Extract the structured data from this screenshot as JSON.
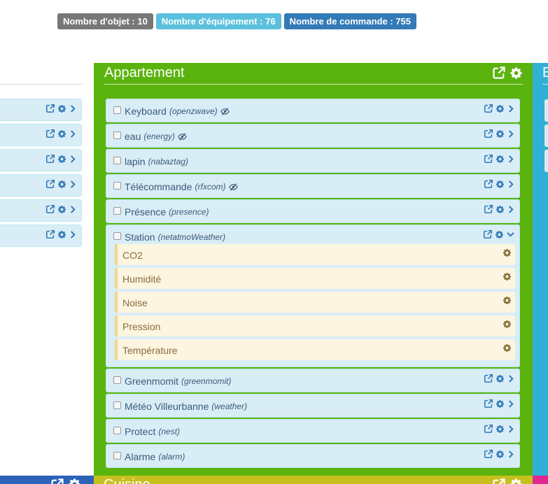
{
  "badges": {
    "objects": "Nombre d'objet : 10",
    "equipments": "Nombre d'équipement : 76",
    "commands": "Nombre de commande : 755"
  },
  "colors": {
    "badge_objects": "#777777",
    "badge_equipments": "#5bc0de",
    "badge_commands": "#337ab7",
    "panel_green": "#5bb30e",
    "panel_blue": "#31b0d5",
    "panel_dark_blue": "#2c63b8",
    "panel_yellow": "#c8c01e",
    "panel_pink": "#e0268f"
  },
  "right_panel": {
    "title": "E"
  },
  "panel": {
    "title": "Appartement",
    "equipments": [
      {
        "name": "Keyboard",
        "plugin": "(openzwave)",
        "hidden_icon": true
      },
      {
        "name": "eau",
        "plugin": "(energy)",
        "hidden_icon": true
      },
      {
        "name": "lapin",
        "plugin": "(nabaztag)",
        "hidden_icon": false
      },
      {
        "name": "Télécommande",
        "plugin": "(rfxcom)",
        "hidden_icon": true
      },
      {
        "name": "Présence",
        "plugin": "(presence)",
        "hidden_icon": false
      },
      {
        "name": "Station",
        "plugin": "(netatmoWeather)",
        "hidden_icon": false,
        "expanded": true,
        "commands": [
          "CO2",
          "Humidité",
          "Noise",
          "Pression",
          "Température"
        ]
      },
      {
        "name": "Greenmomit",
        "plugin": "(greenmomit)",
        "hidden_icon": false
      },
      {
        "name": "Météo Villeurbanne",
        "plugin": "(weather)",
        "hidden_icon": false
      },
      {
        "name": "Protect",
        "plugin": "(nest)",
        "hidden_icon": false
      },
      {
        "name": "Alarme",
        "plugin": "(alarm)",
        "hidden_icon": false
      }
    ]
  },
  "bottom_panel": {
    "title": "Cuisine"
  },
  "icons": {
    "external": "external-link-icon",
    "gear": "gear-icon",
    "chevron_right": "chevron-right-icon",
    "chevron_down": "chevron-down-icon",
    "eye_slash": "eye-slash-icon"
  }
}
